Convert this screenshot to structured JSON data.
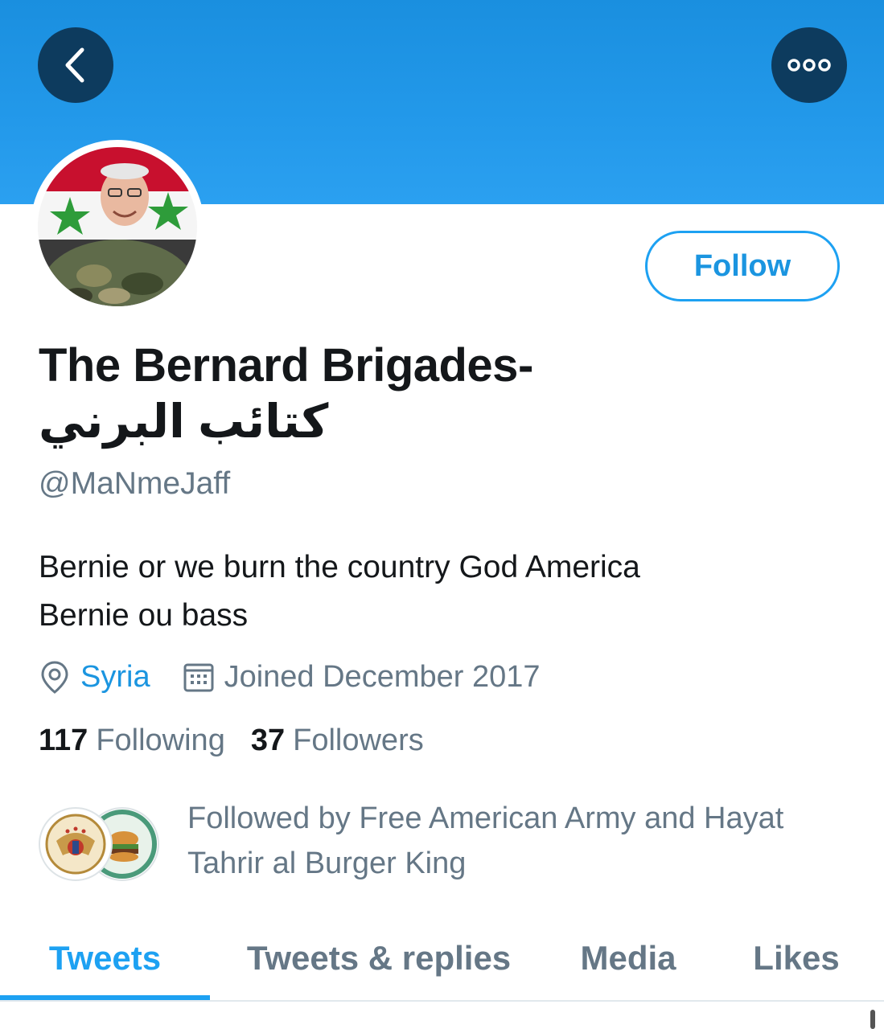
{
  "header": {
    "back_icon": "chevron-left-icon",
    "more_icon": "more-horizontal-icon",
    "banner_color": "#2399ea"
  },
  "profile": {
    "name": "The Bernard Brigades-",
    "name_arabic": "كتائب البرني",
    "handle": "@MaNmeJaff",
    "bio_line1": "Bernie or we burn the country God America",
    "bio_line2": "Bernie ou bass",
    "location": "Syria",
    "joined": "Joined December 2017",
    "following_count": "117",
    "following_label": "Following",
    "followers_count": "37",
    "followers_label": "Followers",
    "followed_by_line1": "Followed by Free American Army and Hayat",
    "followed_by_line2": "Tahrir al Burger King"
  },
  "actions": {
    "follow_label": "Follow"
  },
  "tabs": [
    {
      "label": "Tweets",
      "active": true
    },
    {
      "label": "Tweets & replies",
      "active": false
    },
    {
      "label": "Media",
      "active": false
    },
    {
      "label": "Likes",
      "active": false
    }
  ],
  "colors": {
    "accent": "#1da1f2",
    "secondary_text": "#657786",
    "primary_text": "#14171a"
  }
}
